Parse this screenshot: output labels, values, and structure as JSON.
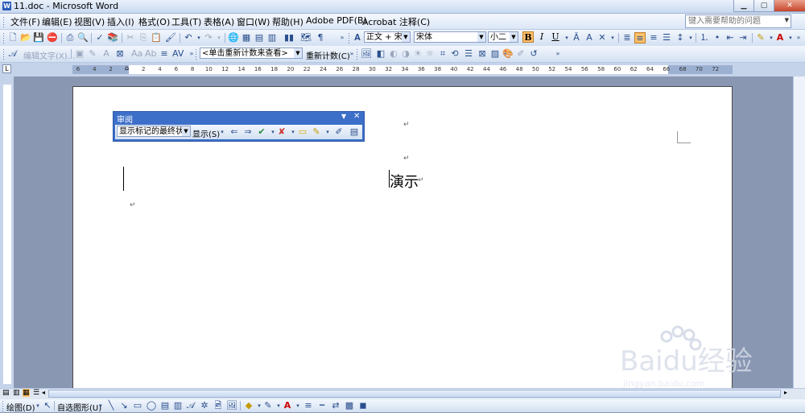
{
  "window": {
    "title": "11.doc - Microsoft Word",
    "icon_letter": "W"
  },
  "window_controls": [
    "minimize-icon",
    "maximize-icon",
    "close-icon"
  ],
  "menu": [
    {
      "label": "文件(F)"
    },
    {
      "label": "编辑(E)"
    },
    {
      "label": "视图(V)"
    },
    {
      "label": "插入(I)"
    },
    {
      "label": "格式(O)"
    },
    {
      "label": "工具(T)"
    },
    {
      "label": "表格(A)"
    },
    {
      "label": "窗口(W)"
    },
    {
      "label": "帮助(H)"
    },
    {
      "label": "Adobe PDF(B)"
    },
    {
      "label": "Acrobat 注释(C)"
    }
  ],
  "help_box": {
    "placeholder": "键入需要帮助的问题"
  },
  "formatting": {
    "style": "正文 + 宋体",
    "font": "宋体",
    "size": "小二",
    "bold": "B",
    "italic": "I",
    "underline": "U"
  },
  "toolbar2": {
    "edit_text": "编辑文字(X)...",
    "count_combo": "<单击重新计数来查看>",
    "recount_button": "重新计数(C)"
  },
  "ruler": {
    "top_ticks": [
      "6",
      "4",
      "2",
      "",
      "2",
      "4",
      "6",
      "8",
      "10",
      "12",
      "14",
      "16",
      "18",
      "20",
      "22",
      "24",
      "26",
      "28",
      "30",
      "32",
      "34",
      "36",
      "38",
      "40",
      "42",
      "44",
      "46",
      "48",
      "50",
      "52",
      "54",
      "56",
      "58",
      "60",
      "62",
      "64",
      "66",
      "68",
      "70",
      "72"
    ],
    "corner_symbol": "L"
  },
  "review_toolbar": {
    "title": "审阅",
    "display_combo": "显示标记的最终状态",
    "show_menu": "显示(S)"
  },
  "document": {
    "text": "演示",
    "paragraph_mark": "↵"
  },
  "draw_toolbar": {
    "draw_menu": "绘图(D)",
    "autoshapes_menu": "自选图形(U)"
  },
  "watermark": {
    "brand": "Baidu经验",
    "url": "jingyan.baidu.com"
  },
  "colors": {
    "title_bg": "#dce7f7",
    "page_bg": "#ffffff",
    "workspace": "#8a97b3",
    "review_title": "#3c6fc8",
    "active_button": "#ffc16b"
  }
}
